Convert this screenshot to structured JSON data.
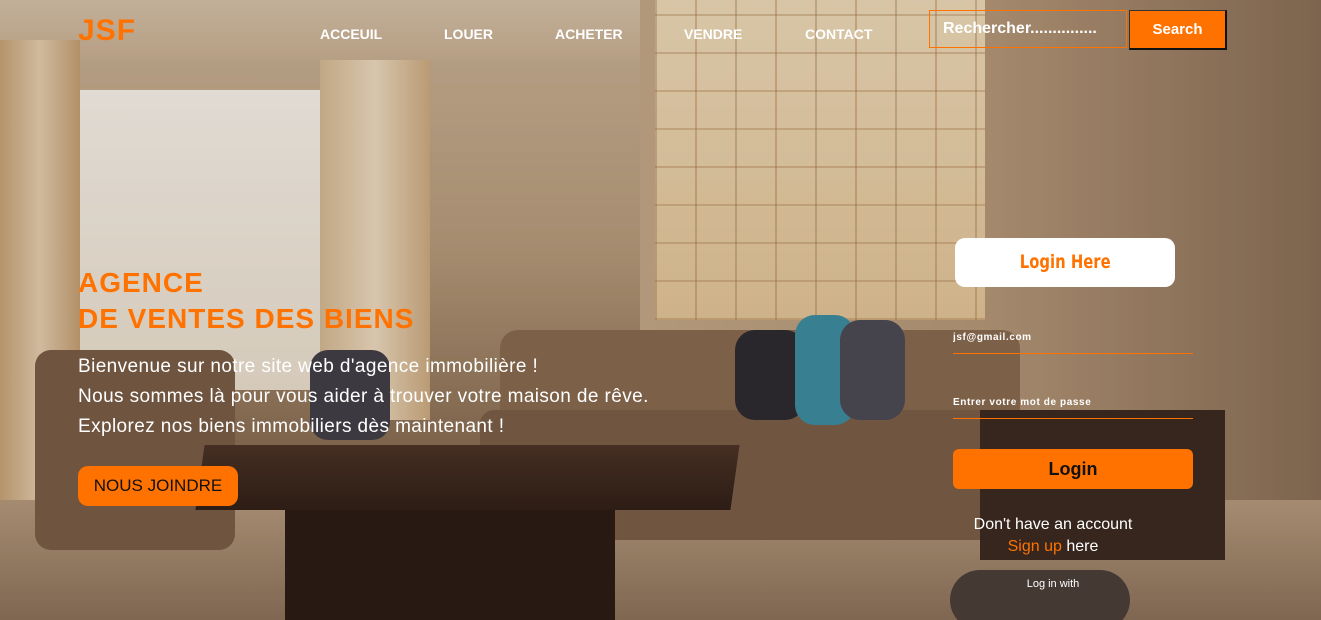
{
  "header": {
    "logo": "JSF",
    "nav": [
      "ACCEUIL",
      "LOUER",
      "ACHETER",
      "VENDRE",
      "CONTACT"
    ],
    "search": {
      "placeholder": "Rechercher...............",
      "button": "Search"
    }
  },
  "hero": {
    "title_line1": "AGENCE",
    "title_line2": "DE VENTES DES BIENS",
    "lines": [
      "Bienvenue sur notre site web d'agence immobilière !",
      "Nous sommes là pour vous aider à trouver votre maison de rêve.",
      "Explorez nos biens immobiliers dès maintenant !"
    ],
    "cta": "NOUS JOINDRE"
  },
  "login": {
    "title": "Login Here",
    "email_placeholder": "jsf@gmail.com",
    "password_placeholder": "Entrer votre mot de passe",
    "button": "Login",
    "no_account": "Don't have an account",
    "signup_link": "Sign up",
    "signup_suffix": " here",
    "login_with": "Log in with"
  },
  "colors": {
    "accent": "#ff7200",
    "text": "#ffffff"
  }
}
